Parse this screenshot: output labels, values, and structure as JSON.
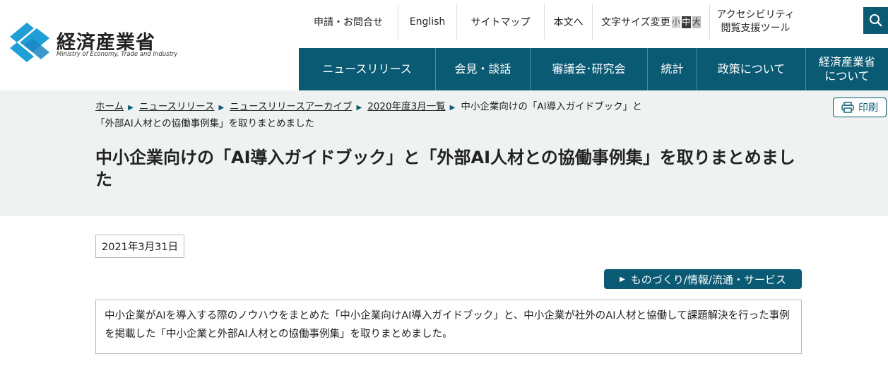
{
  "header": {
    "logo_jp": "経済産業省",
    "logo_en": "Ministry of Economy, Trade and Industry",
    "util": {
      "apply": "申請・お問合せ",
      "english": "English",
      "sitemap": "サイトマップ",
      "main_text": "本文へ",
      "font_size_label": "文字サイズ変更",
      "font_small": "小",
      "font_mid": "中",
      "font_large": "大",
      "access_line1": "アクセシビリティ",
      "access_line2": "閲覧支援ツール"
    },
    "brand_color": "#0a5a74"
  },
  "gnav": {
    "news": "ニュースリリース",
    "press": "会見・談話",
    "council": "審議会･研究会",
    "stats": "統計",
    "policy": "政策について",
    "about_line1": "経済産業省",
    "about_line2": "について"
  },
  "breadcrumb": {
    "home": "ホーム",
    "news": "ニュースリリース",
    "archive": "ニュースリリースアーカイブ",
    "month": "2020年度3月一覧",
    "current": "中小企業向けの「AI導入ガイドブック」と「外部AI人材との協働事例集」を取りまとめました"
  },
  "print_label": "印刷",
  "page_title": "中小企業向けの「AI導入ガイドブック」と「外部AI人材との協働事例集」を取りまとめました",
  "date": "2021年3月31日",
  "category_tag": "ものづくり/情報/流通・サービス",
  "summary": "中小企業がAIを導入する際のノウハウをまとめた「中小企業向けAI導入ガイドブック」と、中小企業が社外のAI人材と協働して課題解決を行った事例を掲載した「中小企業と外部AI人材との協働事例集」を取りまとめました。"
}
